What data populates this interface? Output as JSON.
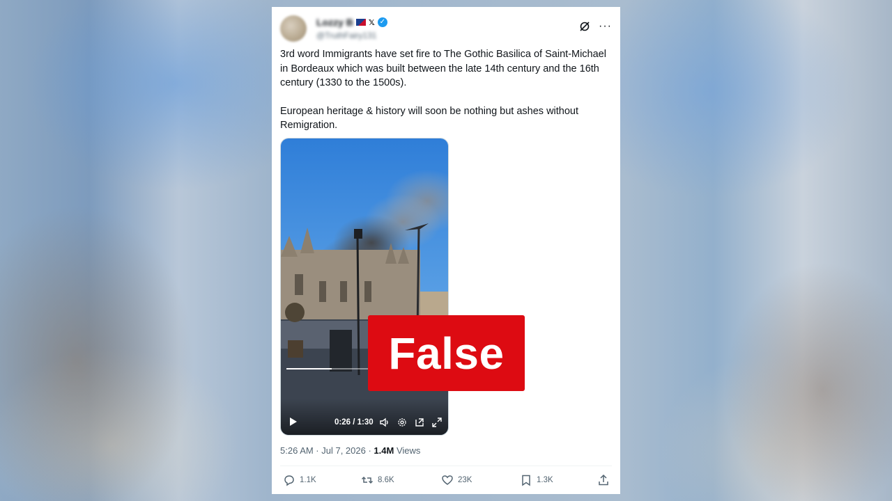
{
  "post": {
    "display_name": "Lozzy B",
    "handle": "@TruthFairy131",
    "text_p1": "3rd word Immigrants have set fire to The Gothic Basilica of Saint-Michael in Bordeaux which was built between the late 14th century and the 16th century (1330 to the 1500s).",
    "text_p2": "European heritage & history will soon be nothing but ashes without Remigration.",
    "timestamp": "5:26 AM · Jul 7, 2026 ·",
    "views_count": "1.4M",
    "views_label": "Views"
  },
  "video": {
    "time": "0:26 / 1:30",
    "progress": 0.29
  },
  "overlay": {
    "label": "False",
    "color": "#dd0b12"
  },
  "actions": {
    "replies": "1.1K",
    "reposts": "8.6K",
    "likes": "23K",
    "bookmarks": "1.3K"
  },
  "icons": [
    "verified-badge-icon",
    "grok-icon",
    "more-icon",
    "play-icon",
    "volume-icon",
    "settings-icon",
    "pip-icon",
    "fullscreen-icon",
    "reply-icon",
    "repost-icon",
    "like-icon",
    "bookmark-icon",
    "share-icon"
  ]
}
